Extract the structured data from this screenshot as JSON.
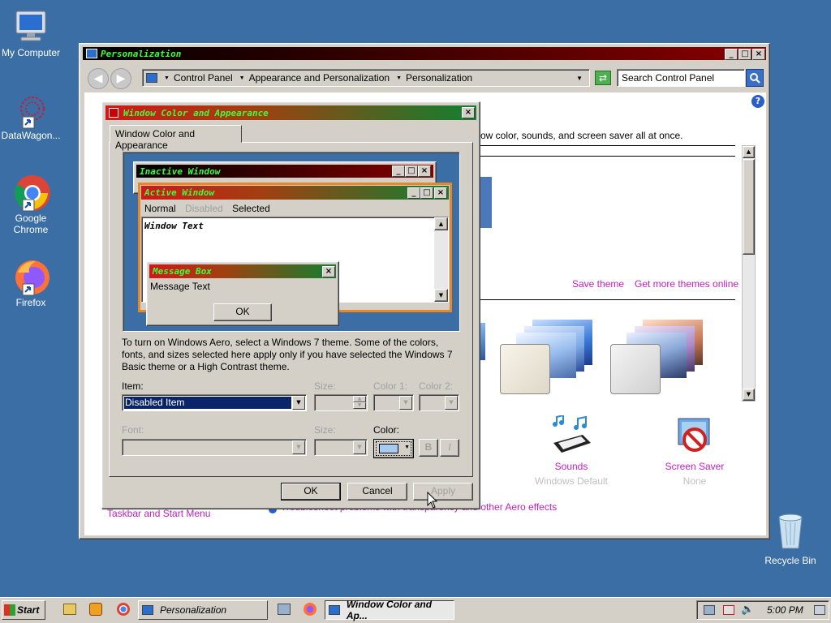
{
  "desktop": {
    "icons": [
      {
        "label": "My Computer"
      },
      {
        "label": "DataWagon..."
      },
      {
        "label": "Google Chrome"
      },
      {
        "label": "Firefox"
      },
      {
        "label": "Recycle Bin"
      }
    ]
  },
  "personalization": {
    "title": "Personalization",
    "breadcrumb": [
      "Control Panel",
      "Appearance and Personalization",
      "Personalization"
    ],
    "search_placeholder": "Search Control Panel",
    "intro_text": "ow color, sounds, and screen saver all at once.",
    "save_theme": "Save theme",
    "get_more_themes": "Get more themes online",
    "sounds_label": "Sounds",
    "sounds_sub": "Windows Default",
    "screensaver_label": "Screen Saver",
    "screensaver_sub": "None",
    "taskbar_link": "Taskbar and Start Menu",
    "trouble_link": "Troubleshoot problems with transparency and other Aero effects"
  },
  "dialog": {
    "title": "Window Color and Appearance",
    "tab": "Window Color and Appearance",
    "preview": {
      "inactive_title": "Inactive Window",
      "active_title": "Active Window",
      "menu_normal": "Normal",
      "menu_disabled": "Disabled",
      "menu_selected": "Selected",
      "window_text": "Window Text",
      "msgbox_title": "Message Box",
      "msgbox_text": "Message Text",
      "msgbox_ok": "OK"
    },
    "info_text": "To turn on Windows Aero, select a Windows 7 theme.  Some of the colors, fonts, and sizes selected here apply only if you have selected the Windows 7 Basic theme or a High Contrast theme.",
    "item_label": "Item:",
    "item_value": "Disabled Item",
    "size_label": "Size:",
    "color1_label": "Color 1:",
    "color2_label": "Color 2:",
    "font_label": "Font:",
    "font_size_label": "Size:",
    "color_label": "Color:",
    "bold_label": "B",
    "italic_label": "I",
    "ok": "OK",
    "cancel": "Cancel",
    "apply": "Apply",
    "color_swatch": "#a6caf0"
  },
  "taskbar": {
    "start": "Start",
    "items": [
      "Personalization",
      "Window Color and Ap..."
    ],
    "clock": "5:00 PM"
  }
}
